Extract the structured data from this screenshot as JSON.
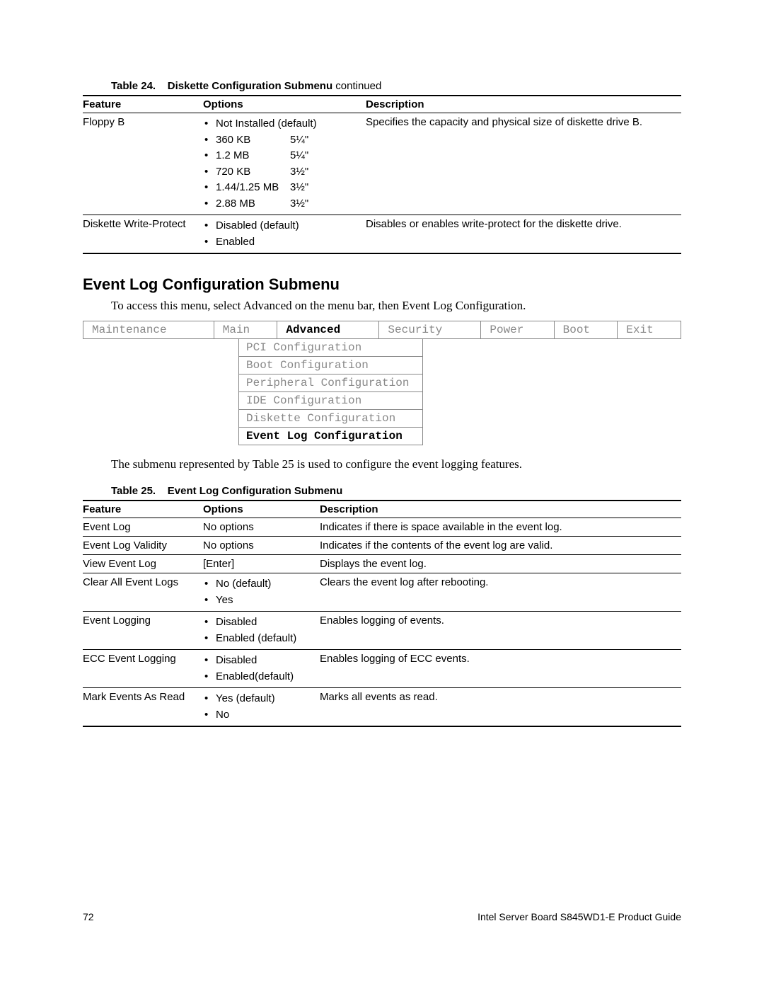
{
  "table24": {
    "caption_label": "Table 24.",
    "caption_title": "Diskette Configuration Submenu",
    "caption_cont": " continued",
    "headers": {
      "feature": "Feature",
      "options": "Options",
      "description": "Description"
    },
    "rows": [
      {
        "feature": "Floppy B",
        "options_twocol": [
          {
            "size": "Not Installed (default)",
            "dim": ""
          },
          {
            "size": "360 KB",
            "dim": "5¼\""
          },
          {
            "size": "1.2 MB",
            "dim": "5¼\""
          },
          {
            "size": "720 KB",
            "dim": "3½\""
          },
          {
            "size": "1.44/1.25 MB",
            "dim": "3½\""
          },
          {
            "size": "2.88 MB",
            "dim": "3½\""
          }
        ],
        "description": "Specifies the capacity and physical size of diskette drive B."
      },
      {
        "feature": "Diskette Write-Protect",
        "options": [
          "Disabled (default)",
          "Enabled"
        ],
        "description": "Disables or enables write-protect for the diskette drive."
      }
    ]
  },
  "section_heading": "Event Log Configuration Submenu",
  "intro_text": "To access this menu, select Advanced on the menu bar, then Event Log Configuration.",
  "menubar": {
    "items": [
      "Maintenance",
      "Main",
      "Advanced",
      "Security",
      "Power",
      "Boot",
      "Exit"
    ],
    "active_index": 2
  },
  "submenu": {
    "items": [
      "PCI Configuration",
      "Boot Configuration",
      "Peripheral Configuration",
      "IDE Configuration",
      "Diskette Configuration",
      "Event Log Configuration"
    ],
    "active_index": 5
  },
  "post_menu_text": "The submenu represented by Table 25 is used to configure the event logging features.",
  "table25": {
    "caption_label": "Table 25.",
    "caption_title": "Event Log Configuration Submenu",
    "headers": {
      "feature": "Feature",
      "options": "Options",
      "description": "Description"
    },
    "rows": [
      {
        "feature": "Event Log",
        "options_text": "No options",
        "description": "Indicates if there is space available in the event log."
      },
      {
        "feature": "Event Log Validity",
        "options_text": "No options",
        "description": "Indicates if the contents of the event log are valid."
      },
      {
        "feature": "View Event Log",
        "options_text": "[Enter]",
        "description": "Displays the event log."
      },
      {
        "feature": "Clear All Event Logs",
        "options": [
          "No (default)",
          "Yes"
        ],
        "description": "Clears the event log after rebooting."
      },
      {
        "feature": "Event Logging",
        "options": [
          "Disabled",
          "Enabled (default)"
        ],
        "description": "Enables logging of events."
      },
      {
        "feature": "ECC Event Logging",
        "options": [
          "Disabled",
          "Enabled(default)"
        ],
        "description": "Enables logging of ECC events."
      },
      {
        "feature": "Mark Events As Read",
        "options": [
          "Yes (default)",
          "No"
        ],
        "description": "Marks all events as read."
      }
    ]
  },
  "footer": {
    "page": "72",
    "doc": "Intel Server Board S845WD1-E Product Guide"
  }
}
